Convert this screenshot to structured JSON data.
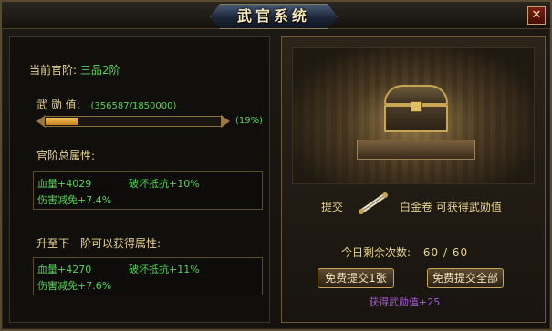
{
  "window": {
    "title": "武官系统",
    "close_glyph": "✕"
  },
  "left_panel": {
    "current_rank_label": "当前官阶:",
    "current_rank_value": "三品2阶",
    "merit_label": "武 勋 值:",
    "merit_value": "(356587/1850000)",
    "merit_progress_fraction": 0.19,
    "merit_percent_text": "(19%)",
    "total_attr_title": "官阶总属性:",
    "total_attrs": {
      "hp": "血量+4029",
      "break_resist": "破坏抵抗+10%",
      "dmg_reduce": "伤害减免+7.4%"
    },
    "next_attr_title": "升至下一阶可以获得属性:",
    "next_attrs": {
      "hp": "血量+4270",
      "break_resist": "破坏抵抗+11%",
      "dmg_reduce": "伤害减免+7.6%"
    }
  },
  "right_panel": {
    "submit_label": "提交",
    "scroll_icon": "scroll-icon",
    "submit_item_text": "白金卷 可获得武勋值",
    "daily_count_label": "今日剩余次数:",
    "daily_count_value": "60 / 60",
    "btn_submit_one": "免费提交1张",
    "btn_submit_all": "免费提交全部",
    "bonus_note": "获得武勋值+25"
  },
  "colors": {
    "accent_gold": "#c7a552",
    "text_green": "#58d05a",
    "text_yellow": "#e6d28c",
    "text_purple": "#a45bd0"
  }
}
